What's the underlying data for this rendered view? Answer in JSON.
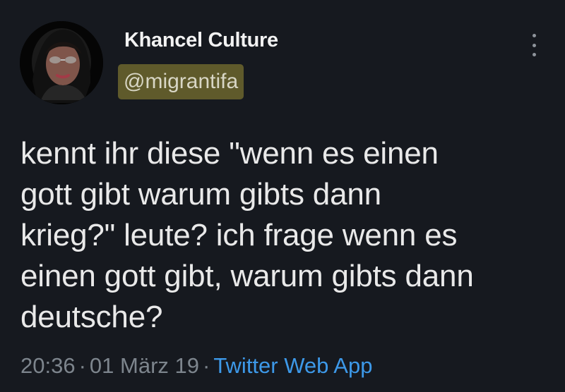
{
  "author": {
    "display_name": "Khancel Culture",
    "handle": "@migrantifa"
  },
  "tweet": {
    "lines": [
      "kennt ihr diese \"wenn es einen",
      "gott gibt warum gibts dann",
      "krieg?\" leute? ich frage wenn es",
      "einen gott gibt, warum gibts dann",
      "deutsche?"
    ]
  },
  "meta": {
    "time": "20:36",
    "separator": "·",
    "date": "01 März 19",
    "source": "Twitter Web App"
  },
  "icons": {
    "more": "more-vertical-icon"
  },
  "colors": {
    "background": "#16191f",
    "handle_highlight": "#5f5a2b",
    "link": "#3d99e9",
    "muted": "#7d858d"
  }
}
